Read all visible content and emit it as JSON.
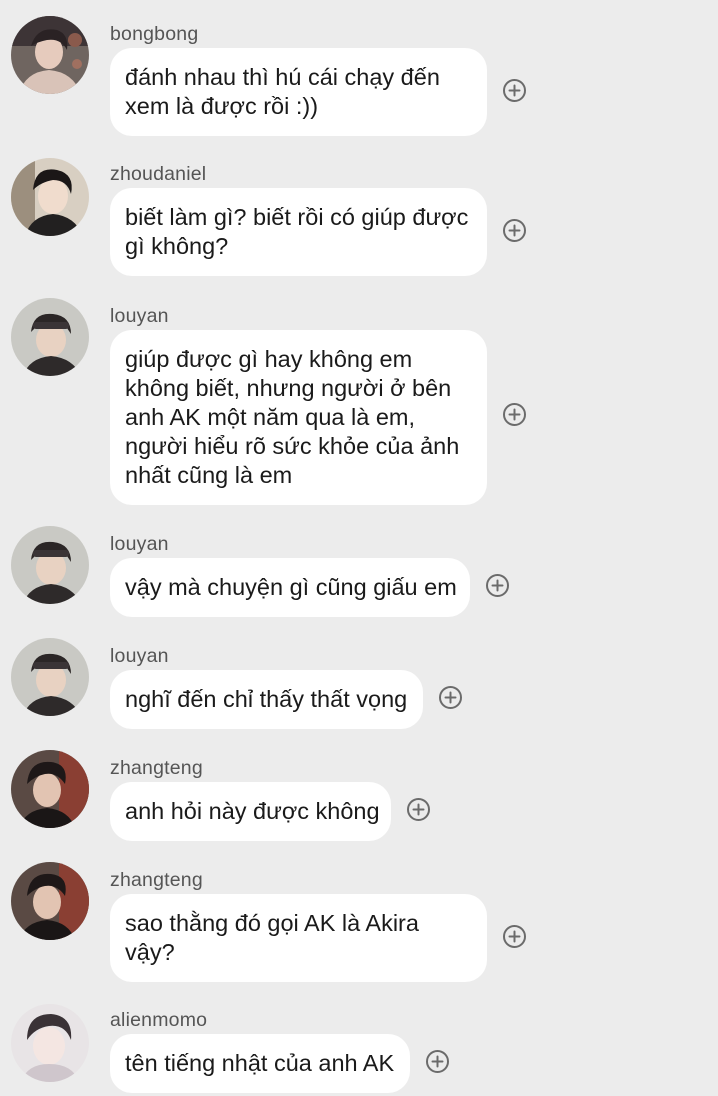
{
  "messages": [
    {
      "username": "bongbong",
      "lines": [
        "đánh nhau thì hú cái chạy đến",
        "xem là được rồi :))"
      ],
      "avatar": "avatar-bongbong"
    },
    {
      "username": "zhoudaniel",
      "lines": [
        "biết làm gì? biết rồi có giúp được",
        "gì không?"
      ],
      "avatar": "avatar-zhoudaniel"
    },
    {
      "username": "louyan",
      "lines": [
        "giúp được gì hay không em",
        "không biết, nhưng người ở bên",
        "anh AK một năm qua là em,",
        "người hiểu rõ sức khỏe của ảnh",
        "nhất cũng là em"
      ],
      "avatar": "avatar-louyan"
    },
    {
      "username": "louyan",
      "lines": [
        "vậy mà chuyện gì cũng giấu em"
      ],
      "avatar": "avatar-louyan"
    },
    {
      "username": "louyan",
      "lines": [
        "nghĩ đến chỉ thấy thất vọng"
      ],
      "avatar": "avatar-louyan"
    },
    {
      "username": "zhangteng",
      "lines": [
        "anh hỏi này được không"
      ],
      "avatar": "avatar-zhangteng"
    },
    {
      "username": "zhangteng",
      "lines": [
        "sao thằng đó gọi AK là Akira",
        "vậy?"
      ],
      "avatar": "avatar-zhangteng"
    },
    {
      "username": "alienmomo",
      "lines": [
        "tên tiếng nhật của anh AK"
      ],
      "avatar": "avatar-alienmomo"
    }
  ],
  "icons": {
    "add": "plus-circle-icon"
  },
  "colors": {
    "background": "#ececec",
    "bubble": "#ffffff",
    "username": "#555555",
    "text": "#1a1a1a",
    "icon": "#6b6b6b"
  }
}
